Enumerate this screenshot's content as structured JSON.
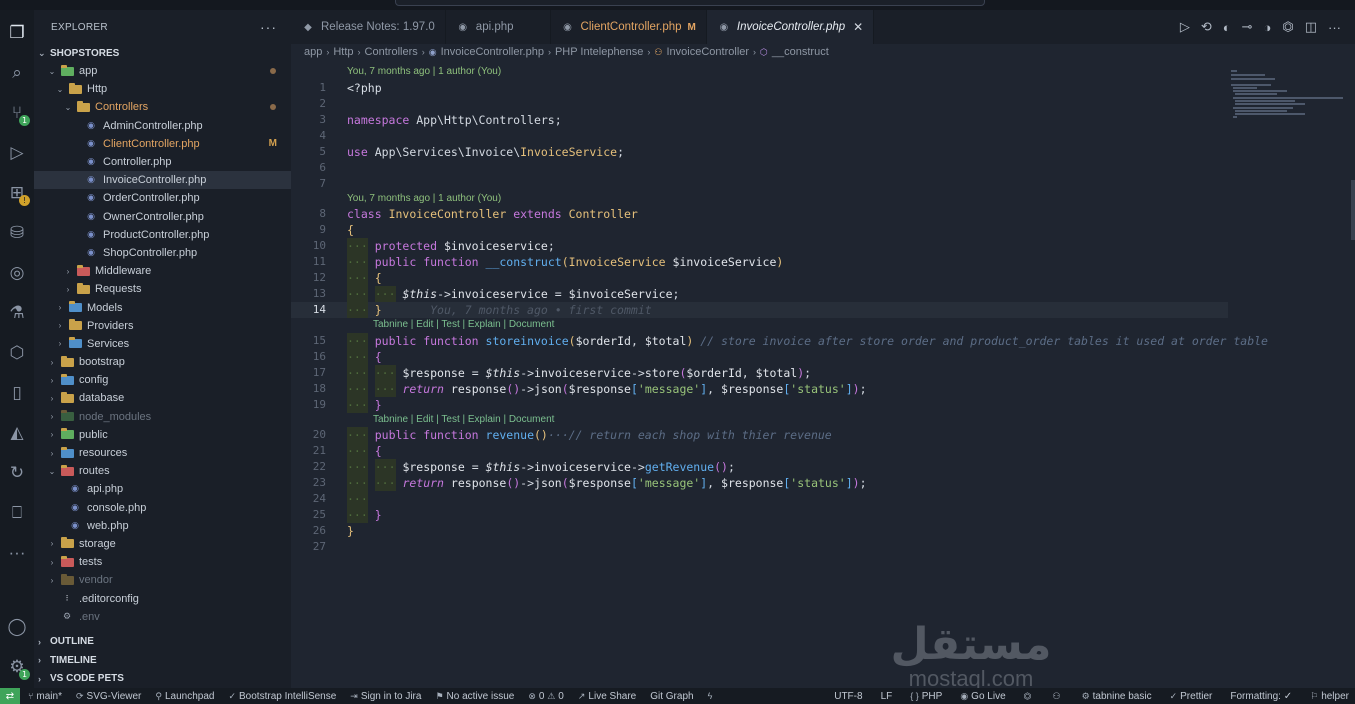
{
  "sidebar": {
    "title": "EXPLORER",
    "project": "SHOPSTORES",
    "tree": [
      {
        "label": "app",
        "depth": 1,
        "open": true,
        "kind": "folder-app",
        "dot": true
      },
      {
        "label": "Http",
        "depth": 2,
        "open": true,
        "kind": "folder"
      },
      {
        "label": "Controllers",
        "depth": 3,
        "open": true,
        "kind": "folder",
        "dot": true,
        "modified": true
      },
      {
        "label": "AdminController.php",
        "depth": 4,
        "kind": "php"
      },
      {
        "label": "ClientController.php",
        "depth": 4,
        "kind": "php",
        "modified": true,
        "mark": "M"
      },
      {
        "label": "Controller.php",
        "depth": 4,
        "kind": "php"
      },
      {
        "label": "InvoiceController.php",
        "depth": 4,
        "kind": "php",
        "selected": true
      },
      {
        "label": "OrderController.php",
        "depth": 4,
        "kind": "php"
      },
      {
        "label": "OwnerController.php",
        "depth": 4,
        "kind": "php"
      },
      {
        "label": "ProductController.php",
        "depth": 4,
        "kind": "php"
      },
      {
        "label": "ShopController.php",
        "depth": 4,
        "kind": "php"
      },
      {
        "label": "Middleware",
        "depth": 3,
        "open": false,
        "kind": "folder-red"
      },
      {
        "label": "Requests",
        "depth": 3,
        "open": false,
        "kind": "folder"
      },
      {
        "label": "Models",
        "depth": 2,
        "open": false,
        "kind": "folder-blue"
      },
      {
        "label": "Providers",
        "depth": 2,
        "open": false,
        "kind": "folder"
      },
      {
        "label": "Services",
        "depth": 2,
        "open": false,
        "kind": "folder-blue"
      },
      {
        "label": "bootstrap",
        "depth": 1,
        "open": false,
        "kind": "folder"
      },
      {
        "label": "config",
        "depth": 1,
        "open": false,
        "kind": "folder-blue"
      },
      {
        "label": "database",
        "depth": 1,
        "open": false,
        "kind": "folder"
      },
      {
        "label": "node_modules",
        "depth": 1,
        "open": false,
        "kind": "folder-green",
        "dim": true
      },
      {
        "label": "public",
        "depth": 1,
        "open": false,
        "kind": "folder-green"
      },
      {
        "label": "resources",
        "depth": 1,
        "open": false,
        "kind": "folder-blue"
      },
      {
        "label": "routes",
        "depth": 1,
        "open": true,
        "kind": "folder-red"
      },
      {
        "label": "api.php",
        "depth": 2,
        "kind": "php"
      },
      {
        "label": "console.php",
        "depth": 2,
        "kind": "php"
      },
      {
        "label": "web.php",
        "depth": 2,
        "kind": "php"
      },
      {
        "label": "storage",
        "depth": 1,
        "open": false,
        "kind": "folder"
      },
      {
        "label": "tests",
        "depth": 1,
        "open": false,
        "kind": "folder-red"
      },
      {
        "label": "vendor",
        "depth": 1,
        "open": false,
        "kind": "folder",
        "dim": true
      },
      {
        "label": ".editorconfig",
        "depth": 1,
        "kind": "config"
      },
      {
        "label": ".env",
        "depth": 1,
        "kind": "gear",
        "dim": true
      }
    ],
    "bottom_sections": [
      "OUTLINE",
      "TIMELINE",
      "VS CODE PETS"
    ]
  },
  "tabs": [
    {
      "label": "Release Notes: 1.97.0",
      "icon": "vscode-icon"
    },
    {
      "label": "api.php",
      "icon": "php-icon"
    },
    {
      "label": "ClientController.php",
      "icon": "php-icon",
      "modified": true,
      "mark": "M"
    },
    {
      "label": "InvoiceController.php",
      "icon": "php-icon",
      "active": true
    }
  ],
  "breadcrumb": [
    "app",
    "Http",
    "Controllers",
    "InvoiceController.php",
    "PHP Intelephense",
    "InvoiceController",
    "__construct"
  ],
  "code": {
    "blame_1": "You, 7 months ago | 1 author (You)",
    "blame_2": "You, 7 months ago | 1 author (You)",
    "inline_blame": "You, 7 months ago • first commit",
    "tabnine_lens": "Tabnine | Edit | Test | Explain | Document",
    "current_line": 14
  },
  "watermark": {
    "arabic": "مستقل",
    "latin": "mostaql.com"
  },
  "status": {
    "branch": "main*",
    "items_left": [
      "SVG-Viewer",
      "Launchpad",
      "Bootstrap IntelliSense",
      "Sign in to Jira",
      "No active issue",
      "0",
      "0",
      "Live Share",
      "Git Graph"
    ],
    "encoding": "UTF-8",
    "eol": "LF",
    "language": "PHP",
    "go_live": "Go Live",
    "tabnine": "tabnine basic",
    "prettier": "Prettier",
    "formatting": "Formatting: ✓",
    "helper": "helper"
  },
  "colors": {
    "accent_green": "#3fa45a",
    "modified": "#e3a563",
    "keyword": "#c678dd",
    "class": "#e5c07b",
    "function": "#61afef",
    "string": "#98c379"
  }
}
